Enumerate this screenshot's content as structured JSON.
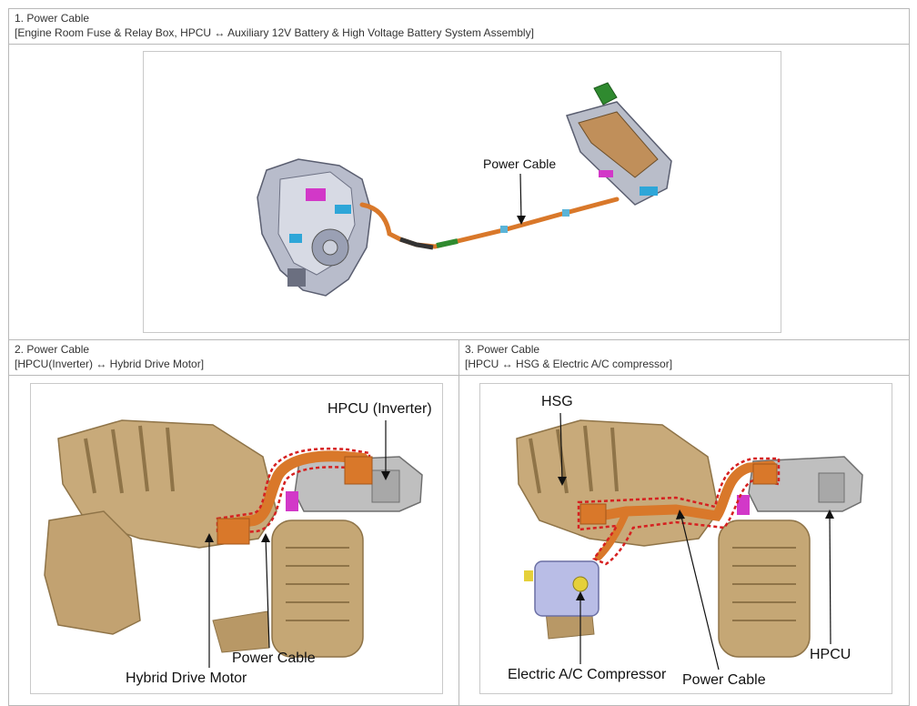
{
  "sections": [
    {
      "title": "1. Power Cable",
      "subtitle": "[Engine Room Fuse & Relay Box, HPCU ↔ Auxiliary 12V Battery & High Voltage Battery System Assembly]",
      "labels": {
        "power_cable": "Power Cable"
      }
    },
    {
      "title": "2. Power Cable",
      "subtitle": "[HPCU(Inverter) ↔ Hybrid Drive Motor]",
      "labels": {
        "hpcu_inverter": "HPCU (Inverter)",
        "power_cable": "Power Cable",
        "hybrid_drive_motor": "Hybrid Drive Motor"
      }
    },
    {
      "title": "3. Power Cable",
      "subtitle": "[HPCU ↔ HSG & Electric A/C compressor]",
      "labels": {
        "hsg": "HSG",
        "hpcu": "HPCU",
        "electric_ac_compressor": "Electric A/C Compressor",
        "power_cable": "Power Cable"
      }
    }
  ],
  "colors": {
    "engine": "#c8aa7a",
    "engine_dark": "#8f7448",
    "cable": "#d9782a",
    "highlight_dash": "#d62020",
    "inverter": "#bfbfbf",
    "connector": "#d238c8"
  }
}
